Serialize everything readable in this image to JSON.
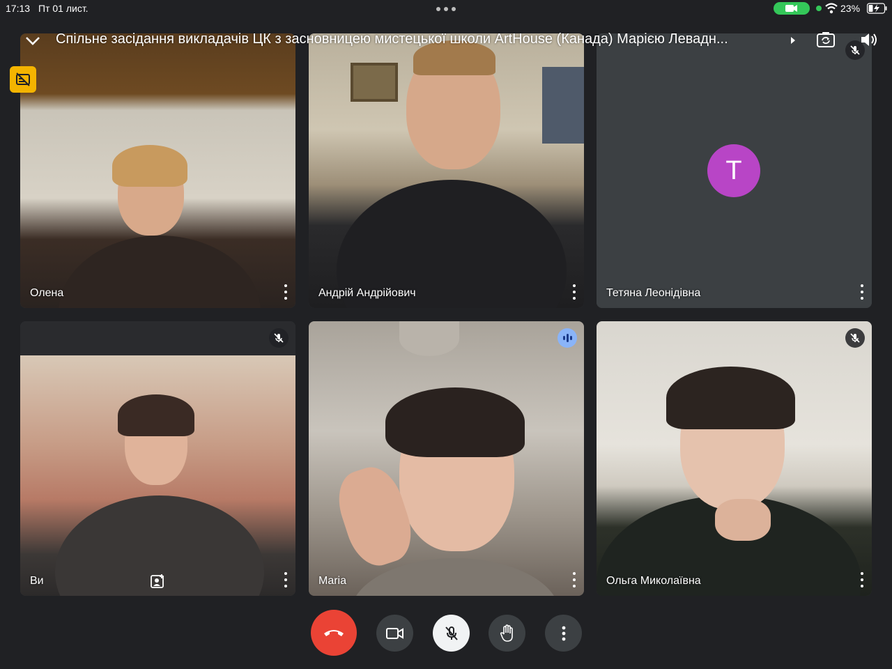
{
  "status_bar": {
    "time": "17:13",
    "date": "Пт 01 лист.",
    "battery_percent": "23%",
    "accent_green": "#34c759"
  },
  "meeting": {
    "title": "Спільне засідання викладачів ЦК з засновницею мистецької школи ArtHouse (Канада) Марією Левадн..."
  },
  "participants": [
    {
      "name": "Олена",
      "mic": "unmuted",
      "video": "on"
    },
    {
      "name": "Андрій Андрійович",
      "mic": "unmuted",
      "video": "on"
    },
    {
      "name": "Тетяна Леонідівна",
      "mic": "muted",
      "video": "off",
      "avatar_letter": "T",
      "avatar_color": "#b845c6"
    },
    {
      "name": "Ви",
      "mic": "muted",
      "video": "on"
    },
    {
      "name": "Maria",
      "mic": "speaking",
      "video": "on"
    },
    {
      "name": "Ольга Миколаївна",
      "mic": "muted",
      "video": "on"
    }
  ],
  "controls": {
    "end_call_color": "#ea4335",
    "icons": [
      "end-call-icon",
      "camera-icon",
      "mic-off-icon",
      "raise-hand-icon",
      "more-vert-icon"
    ]
  }
}
